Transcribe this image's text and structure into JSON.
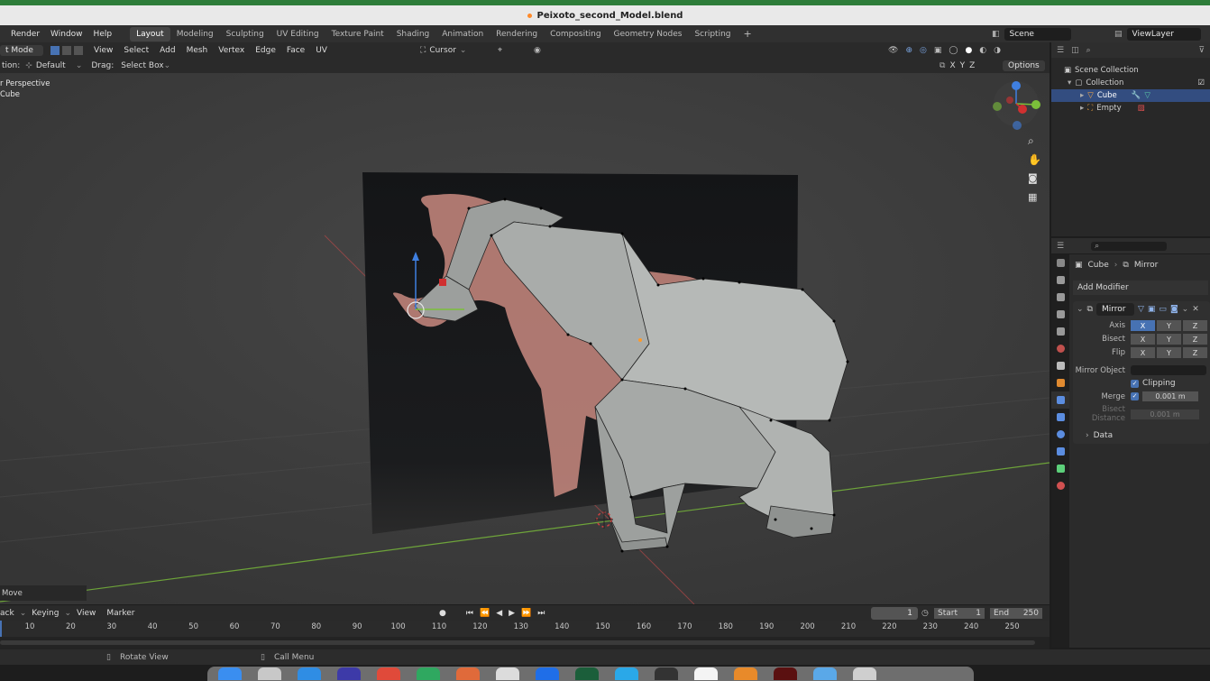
{
  "window": {
    "title": "Peixoto_second_Model.blend"
  },
  "menu": {
    "items": [
      "Render",
      "Window",
      "Help"
    ],
    "workspaces": [
      "Layout",
      "Modeling",
      "Sculpting",
      "UV Editing",
      "Texture Paint",
      "Shading",
      "Animation",
      "Rendering",
      "Compositing",
      "Geometry Nodes",
      "Scripting"
    ],
    "active_workspace": "Layout",
    "scene": "Scene",
    "view_layer": "ViewLayer"
  },
  "viewport_header": {
    "mode": "t Mode",
    "menus": [
      "View",
      "Select",
      "Add",
      "Mesh",
      "Vertex",
      "Edge",
      "Face",
      "UV"
    ],
    "pivot": "Cursor",
    "orientation_label": "tion:",
    "orientation_value": "Default",
    "drag_label": "Drag:",
    "drag_value": "Select Box",
    "axes": [
      "X",
      "Y",
      "Z"
    ],
    "options": "Options"
  },
  "viewport": {
    "view_name": "r Perspective",
    "object_name": "Cube",
    "last_operator": "Move"
  },
  "outliner": {
    "root": "Scene Collection",
    "collection": "Collection",
    "items": [
      "Cube",
      "Empty"
    ],
    "selected": "Cube"
  },
  "properties": {
    "breadcrumb_object": "Cube",
    "breadcrumb_modifier": "Mirror",
    "add_modifier": "Add Modifier",
    "modifier_name": "Mirror",
    "axis_label": "Axis",
    "bisect_label": "Bisect",
    "flip_label": "Flip",
    "axes": [
      "X",
      "Y",
      "Z"
    ],
    "axis_active": "X",
    "mirror_object_label": "Mirror Object",
    "clipping_label": "Clipping",
    "clipping": true,
    "merge_label": "Merge",
    "merge_enabled": true,
    "merge_value": "0.001 m",
    "bisect_distance_label": "Bisect Distance",
    "bisect_distance_value": "0.001 m",
    "data_panel": "Data"
  },
  "timeline": {
    "menus": [
      "ack",
      "Keying",
      "View",
      "Marker"
    ],
    "current_frame": "1",
    "start_label": "Start",
    "start": "1",
    "end_label": "End",
    "end": "250",
    "ticks": [
      10,
      20,
      30,
      40,
      50,
      60,
      70,
      80,
      90,
      100,
      110,
      120,
      130,
      140,
      150,
      160,
      170,
      180,
      190,
      200,
      210,
      220,
      230,
      240,
      250
    ]
  },
  "statusbar": {
    "rotate_view": "Rotate View",
    "call_menu": "Call Menu"
  },
  "colors": {
    "accent": "#4772b3",
    "selection": "#334d80",
    "viewport_bg": "#3d3d3d",
    "x_axis": "#c44a4a",
    "y_axis": "#7bbf3a"
  }
}
